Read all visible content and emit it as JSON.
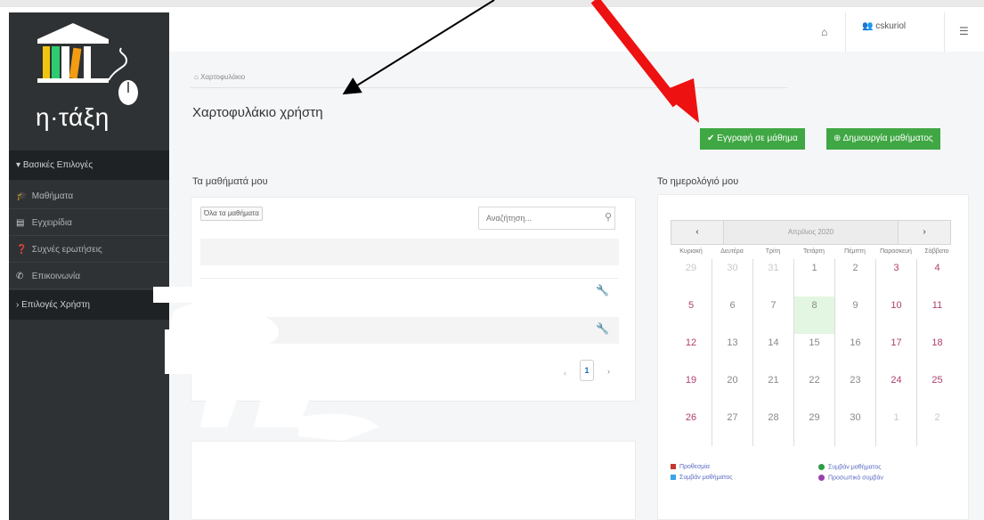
{
  "app": {
    "logo_text": "η·τάξη"
  },
  "sidebar": {
    "section_main": "Βασικές Επιλογές",
    "items": [
      {
        "label": "Μαθήματα",
        "icon": "graduation-cap-icon"
      },
      {
        "label": "Εγχειρίδια",
        "icon": "document-icon"
      },
      {
        "label": "Συχνές ερωτήσεις",
        "icon": "question-icon"
      },
      {
        "label": "Επικοινωνία",
        "icon": "phone-icon"
      }
    ],
    "section_user": "Επιλογές Χρήστη"
  },
  "topbar": {
    "home_icon": "home-icon",
    "username": "cskuriol",
    "menu_icon": "menu-icon"
  },
  "breadcrumb": "Χαρτοφυλάκιο",
  "page_title": "Χαρτοφυλάκιο χρήστη",
  "buttons": {
    "register": "Εγγραφή σε μάθημα",
    "create": "Δημιουργία μαθήματος"
  },
  "courses": {
    "heading": "Τα μαθήματά μου",
    "filter_label": "Όλα τα μαθήματα",
    "search_placeholder": "Αναζήτηση...",
    "page": "1"
  },
  "calendar": {
    "heading": "Το ημερολόγιό μου",
    "month": "Απρίλιος 2020",
    "prev": "‹",
    "next": "›",
    "weekdays": [
      "Κυριακή",
      "Δευτέρα",
      "Τρίτη",
      "Τετάρτη",
      "Πέμπτη",
      "Παρασκευή",
      "Σάββατο"
    ],
    "weeks": [
      [
        "29",
        "30",
        "31",
        "1",
        "2",
        "3",
        "4"
      ],
      [
        "5",
        "6",
        "7",
        "8",
        "9",
        "10",
        "11"
      ],
      [
        "12",
        "13",
        "14",
        "15",
        "16",
        "17",
        "18"
      ],
      [
        "19",
        "20",
        "21",
        "22",
        "23",
        "24",
        "25"
      ],
      [
        "26",
        "27",
        "28",
        "29",
        "30",
        "1",
        "2"
      ]
    ],
    "today": "8",
    "legend": [
      {
        "label": "Προθεσμία",
        "color": "#c0392b"
      },
      {
        "label": "Συμβάν μαθήματος",
        "color": "#2e9d45"
      },
      {
        "label": "Συμβάν μαθήματος",
        "color": "#3ba3e8"
      },
      {
        "label": "Προσωπικό συμβάν",
        "color": "#9b3fae"
      }
    ]
  },
  "colors": {
    "sidebar_bg": "#2f3234",
    "accent_green": "#3fa743",
    "today_bg": "#e3f6e1"
  }
}
